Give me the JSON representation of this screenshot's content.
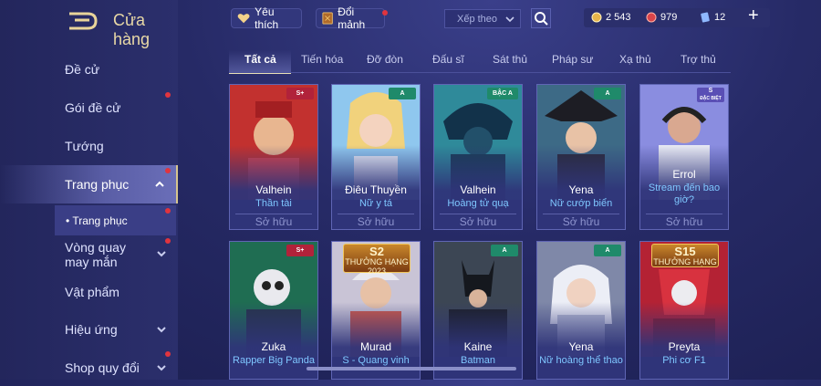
{
  "sidebar": {
    "title": "Cửa hàng",
    "items": [
      {
        "label": "Đề cử"
      },
      {
        "label": "Gói đề cử"
      },
      {
        "label": "Tướng"
      },
      {
        "label": "Trang phục"
      },
      {
        "label": "Vòng quay may mắn"
      },
      {
        "label": "Vật phẩm"
      },
      {
        "label": "Hiệu ứng"
      },
      {
        "label": "Shop quy đổi"
      }
    ],
    "sub_item": "• Trang phục"
  },
  "topbar": {
    "favorite": "Yêu thích",
    "exchange": "Đổi mảnh",
    "sort_placeholder": "Xếp theo",
    "currency": {
      "gold": "2 543",
      "vouchers": "979",
      "gems": "12"
    }
  },
  "tabs": [
    "Tất cả",
    "Tiến hóa",
    "Đỡ đòn",
    "Đấu sĩ",
    "Sát thủ",
    "Pháp sư",
    "Xạ thủ",
    "Trợ thủ"
  ],
  "cards_row1": [
    {
      "hero": "Valhein",
      "skin": "Thần tài",
      "status": "Sở hữu",
      "badge": "S+"
    },
    {
      "hero": "Điêu Thuyền",
      "skin": "Nữ y tá",
      "status": "Sở hữu",
      "badge": "A"
    },
    {
      "hero": "Valhein",
      "skin": "Hoàng tử quạ",
      "status": "Sở hữu",
      "badge": "BẬC A"
    },
    {
      "hero": "Yena",
      "skin": "Nữ cướp biển",
      "status": "Sở hữu",
      "badge": "A"
    },
    {
      "hero": "Errol",
      "skin": "Stream đến bao giờ?",
      "status": "Sở hữu",
      "badge": "S"
    }
  ],
  "cards_row2": [
    {
      "hero": "Zuka",
      "skin": "Rapper Big Panda",
      "badge": "S+"
    },
    {
      "hero": "Murad",
      "skin": "S - Quang vinh",
      "season_big": "S2",
      "season_small": "THƯỞNG HẠNG",
      "season_year": "2023"
    },
    {
      "hero": "Kaine",
      "skin": "Batman",
      "badge": "A"
    },
    {
      "hero": "Yena",
      "skin": "Nữ hoàng thể thao",
      "badge": "A"
    },
    {
      "hero": "Preyta",
      "skin": "Phi cơ F1",
      "season_big": "S15",
      "season_small": "THƯỞNG HẠNG"
    }
  ]
}
